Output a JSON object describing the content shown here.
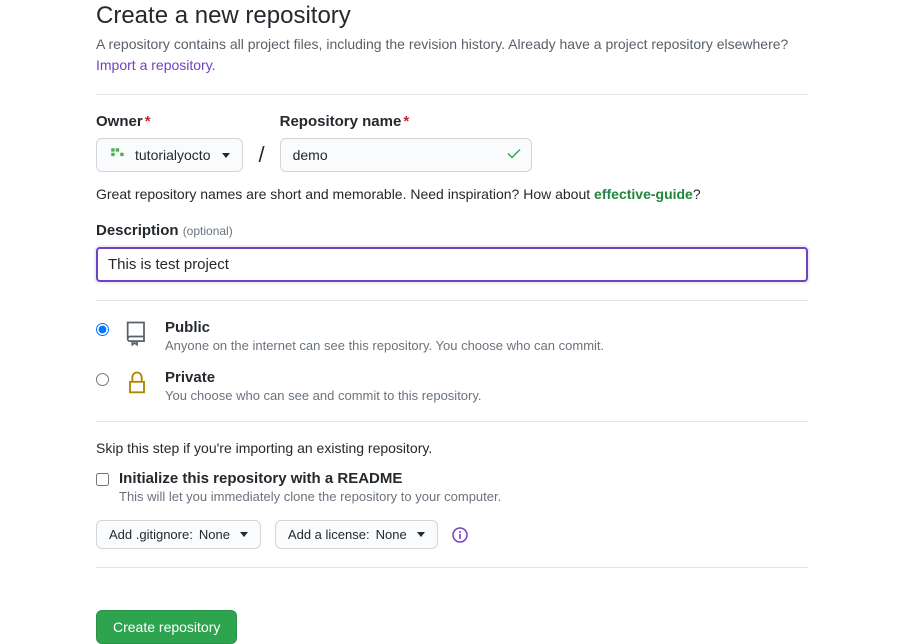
{
  "header": {
    "title": "Create a new repository",
    "subtitle_part1": "A repository contains all project files, including the revision history. Already have a project repository elsewhere?",
    "import_link": "Import a repository."
  },
  "owner": {
    "label": "Owner",
    "selected": "tutorialyocto"
  },
  "repo_name": {
    "label": "Repository name",
    "value": "demo"
  },
  "hint": {
    "prefix": "Great repository names are short and memorable. Need inspiration? How about ",
    "suggestion": "effective-guide",
    "suffix": "?"
  },
  "description": {
    "label": "Description",
    "optional": "(optional)",
    "value": "This is test project"
  },
  "visibility": {
    "public": {
      "title": "Public",
      "desc": "Anyone on the internet can see this repository. You choose who can commit."
    },
    "private": {
      "title": "Private",
      "desc": "You choose who can see and commit to this repository."
    }
  },
  "init": {
    "skip_hint": "Skip this step if you're importing an existing repository.",
    "readme_label": "Initialize this repository with a README",
    "readme_desc": "This will let you immediately clone the repository to your computer.",
    "gitignore_prefix": "Add .gitignore: ",
    "gitignore_value": "None",
    "license_prefix": "Add a license: ",
    "license_value": "None"
  },
  "submit": {
    "label": "Create repository"
  }
}
